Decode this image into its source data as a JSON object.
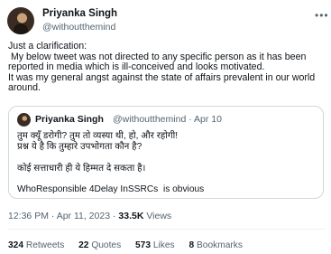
{
  "author": {
    "name": "Priyanka Singh",
    "handle": "@withoutthemind"
  },
  "more_icon": "more-horizontal-icon",
  "tweet_lines": [
    "Just a clarification:",
    " My below tweet was not directed to any specific person as it has been",
    "reported in media which is ill-conceived and looks motivated.",
    "It was my general angst against the state of affairs prevalent in our world",
    "around."
  ],
  "quoted": {
    "name": "Priyanka Singh",
    "handle_date": "@withoutthemind · Apr 10",
    "lines": [
      "तुम क्यूँ डरोगी? तुम तो व्यस्या थी, हो, और रहोगी!",
      "प्रश्न ये है कि तुम्हारे उपभोगता कौन है?",
      "कोई सत्ताधारी ही ये हिम्मत दे सकता है।",
      "WhoResponsible 4Delay InSSRCs  is obvious"
    ]
  },
  "meta": {
    "timestamp": "12:36 PM · Apr 11, 2023 · ",
    "views_count": "33.5K",
    "views_label": " Views"
  },
  "stats": {
    "retweets_count": "324",
    "retweets_label": " Retweets",
    "quotes_count": "22",
    "quotes_label": " Quotes",
    "likes_count": "573",
    "likes_label": " Likes",
    "bookmarks_count": "8",
    "bookmarks_label": " Bookmarks"
  }
}
